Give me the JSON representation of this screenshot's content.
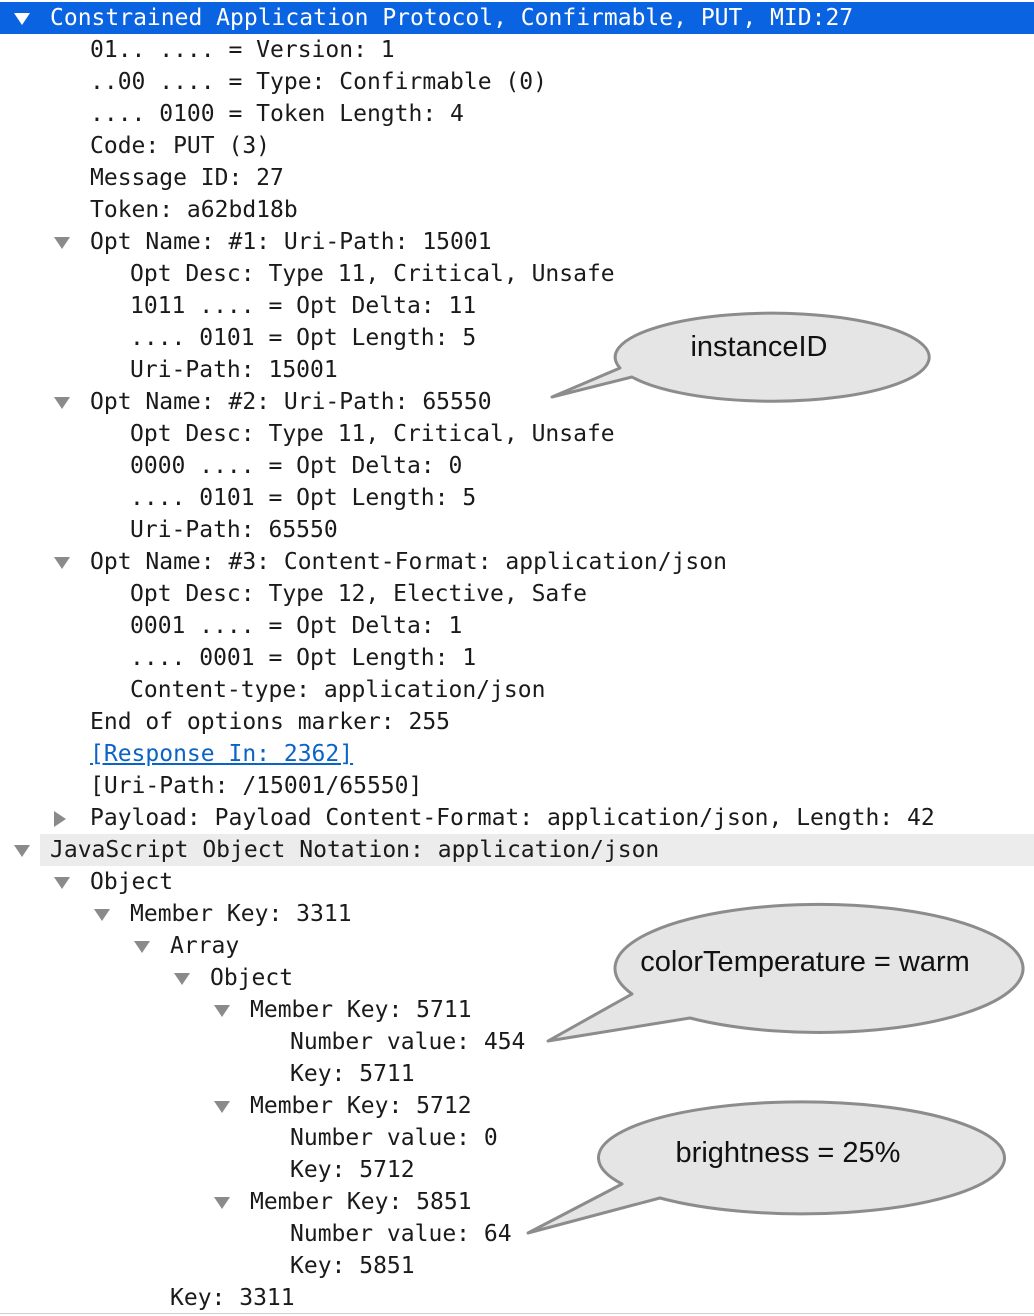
{
  "rows": [
    {
      "text": "Constrained Application Protocol, Confirmable, PUT, MID:27",
      "level": 0,
      "toggle": "open",
      "kind": "selected"
    },
    {
      "text": "01.. .... = Version: 1",
      "level": 1
    },
    {
      "text": "..00 .... = Type: Confirmable (0)",
      "level": 1
    },
    {
      "text": ".... 0100 = Token Length: 4",
      "level": 1
    },
    {
      "text": "Code: PUT (3)",
      "level": 1
    },
    {
      "text": "Message ID: 27",
      "level": 1
    },
    {
      "text": "Token: a62bd18b",
      "level": 1
    },
    {
      "text": "Opt Name: #1: Uri-Path: 15001",
      "level": 1,
      "toggle": "open"
    },
    {
      "text": "Opt Desc: Type 11, Critical, Unsafe",
      "level": 2
    },
    {
      "text": "1011 .... = Opt Delta: 11",
      "level": 2
    },
    {
      "text": ".... 0101 = Opt Length: 5",
      "level": 2
    },
    {
      "text": "Uri-Path: 15001",
      "level": 2
    },
    {
      "text": "Opt Name: #2: Uri-Path: 65550",
      "level": 1,
      "toggle": "open"
    },
    {
      "text": "Opt Desc: Type 11, Critical, Unsafe",
      "level": 2
    },
    {
      "text": "0000 .... = Opt Delta: 0",
      "level": 2
    },
    {
      "text": ".... 0101 = Opt Length: 5",
      "level": 2
    },
    {
      "text": "Uri-Path: 65550",
      "level": 2
    },
    {
      "text": "Opt Name: #3: Content-Format: application/json",
      "level": 1,
      "toggle": "open"
    },
    {
      "text": "Opt Desc: Type 12, Elective, Safe",
      "level": 2
    },
    {
      "text": "0001 .... = Opt Delta: 1",
      "level": 2
    },
    {
      "text": ".... 0001 = Opt Length: 1",
      "level": 2
    },
    {
      "text": "Content-type: application/json",
      "level": 2
    },
    {
      "text": "End of options marker: 255",
      "level": 1
    },
    {
      "text": "[Response In: 2362]",
      "level": 1,
      "kind": "link"
    },
    {
      "text": "[Uri-Path: /15001/65550]",
      "level": 1
    },
    {
      "text": "Payload: Payload Content-Format: application/json, Length: 42",
      "level": 1,
      "toggle": "closed"
    },
    {
      "text": "JavaScript Object Notation: application/json",
      "level": 0,
      "toggle": "open",
      "kind": "section"
    },
    {
      "text": "Object",
      "level": 1,
      "toggle": "open"
    },
    {
      "text": "Member Key: 3311",
      "level": 2,
      "toggle": "open"
    },
    {
      "text": "Array",
      "level": 3,
      "toggle": "open"
    },
    {
      "text": "Object",
      "level": 4,
      "toggle": "open"
    },
    {
      "text": "Member Key: 5711",
      "level": 5,
      "toggle": "open"
    },
    {
      "text": "Number value: 454",
      "level": 6
    },
    {
      "text": "Key: 5711",
      "level": 6
    },
    {
      "text": "Member Key: 5712",
      "level": 5,
      "toggle": "open"
    },
    {
      "text": "Number value: 0",
      "level": 6
    },
    {
      "text": "Key: 5712",
      "level": 6
    },
    {
      "text": "Member Key: 5851",
      "level": 5,
      "toggle": "open"
    },
    {
      "text": "Number value: 64",
      "level": 6
    },
    {
      "text": "Key: 5851",
      "level": 6
    },
    {
      "text": "Key: 3311",
      "level": 3
    }
  ],
  "callouts": {
    "instance": "instanceID",
    "color": "colorTemperature = warm",
    "brightness": "brightness = 25%"
  },
  "colors": {
    "selection": "#0a63e0",
    "section_bg": "#ececec",
    "link": "#0b63c5",
    "callout_fill": "#e5e5e5",
    "callout_stroke": "#8c8c8c"
  }
}
